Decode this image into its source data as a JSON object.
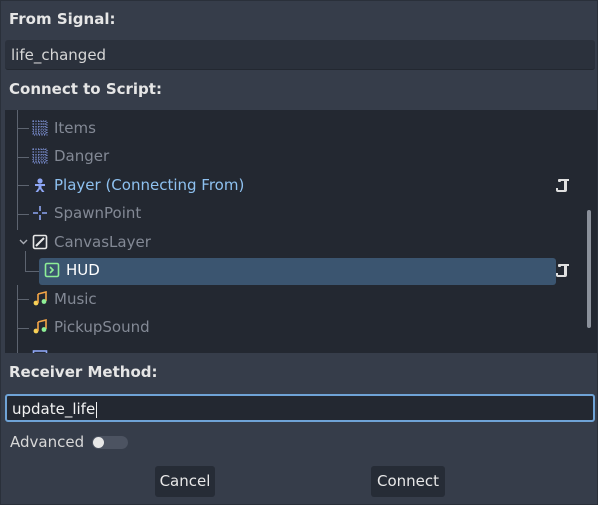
{
  "from_signal": {
    "label": "From Signal:",
    "value": "life_changed"
  },
  "connect_to_script": {
    "label": "Connect to Script:",
    "nodes": [
      {
        "name": "Items",
        "icon": "tilemap-icon"
      },
      {
        "name": "Danger",
        "icon": "tilemap-icon"
      },
      {
        "name": "Player (Connecting From)",
        "icon": "character-body-icon",
        "has_script": true
      },
      {
        "name": "SpawnPoint",
        "icon": "marker-icon"
      },
      {
        "name": "CanvasLayer",
        "icon": "canvas-layer-icon"
      },
      {
        "name": "HUD",
        "icon": "control-icon",
        "has_script": true,
        "selected": true
      },
      {
        "name": "Music",
        "icon": "audio-stream-player-icon"
      },
      {
        "name": "PickupSound",
        "icon": "audio-stream-player-icon"
      },
      {
        "name": "",
        "icon": "node-icon"
      }
    ]
  },
  "receiver_method": {
    "label": "Receiver Method:",
    "value": "update_life"
  },
  "advanced": {
    "label": "Advanced",
    "enabled": false
  },
  "buttons": {
    "cancel": "Cancel",
    "connect": "Connect"
  },
  "colors": {
    "selection": "#3b5570",
    "connecting_text": "#8ec1f0",
    "focus_border": "#6fa3d6"
  }
}
